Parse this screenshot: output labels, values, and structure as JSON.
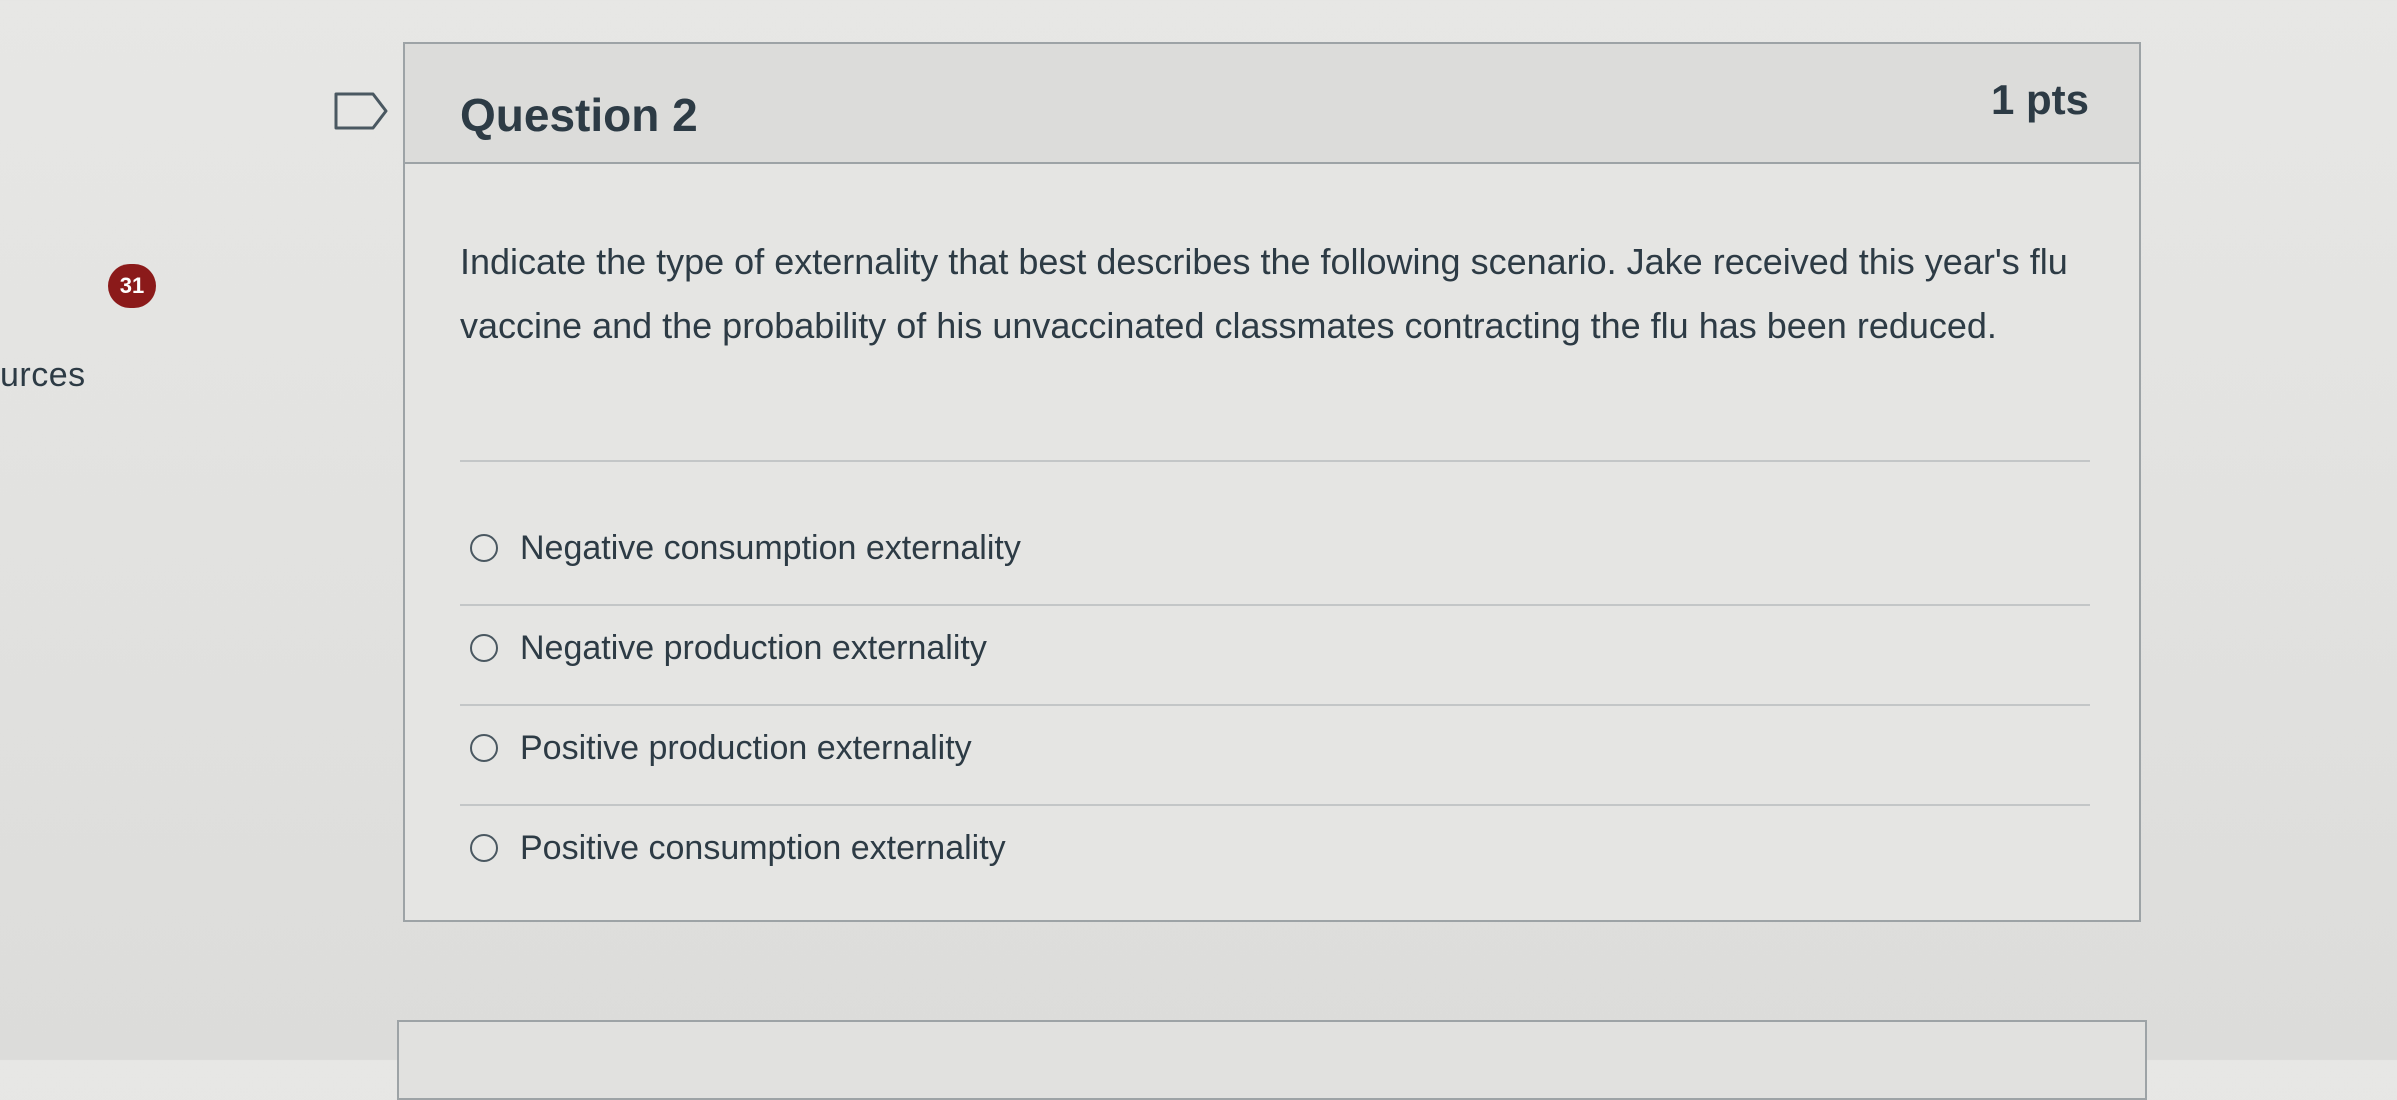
{
  "sidebar": {
    "partial_label": "urces"
  },
  "badge": {
    "count": "31"
  },
  "question": {
    "title": "Question 2",
    "points": "1 pts",
    "text": "Indicate the type of externality that best describes the following scenario. Jake received this year's flu vaccine and the probability of his unvaccinated classmates contracting the flu has been reduced.",
    "answers": [
      {
        "label": "Negative consumption externality",
        "selected": false
      },
      {
        "label": "Negative production externality",
        "selected": false
      },
      {
        "label": "Positive production externality",
        "selected": false
      },
      {
        "label": "Positive consumption externality",
        "selected": false
      }
    ]
  },
  "icons": {
    "flag": "flag-bookmark-icon",
    "radio": "radio-circle-icon"
  },
  "colors": {
    "badge": "#8b1a1a",
    "text": "#2d3b45",
    "border": "#9da3a6"
  }
}
